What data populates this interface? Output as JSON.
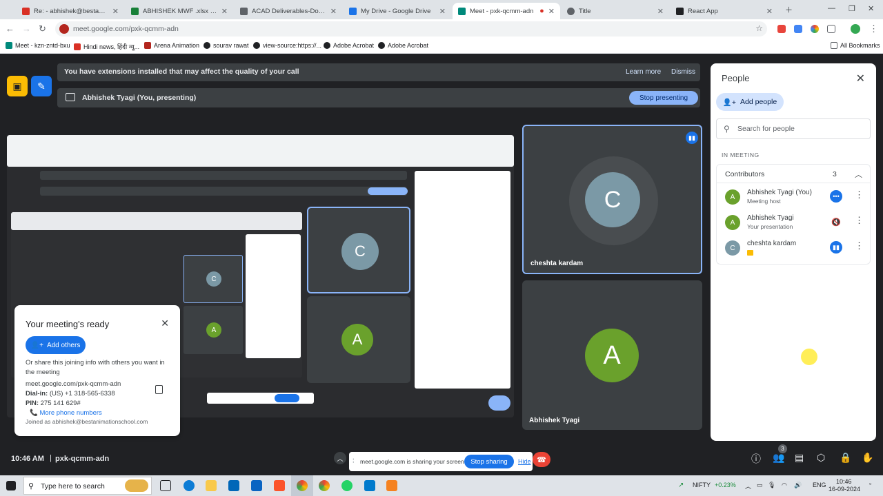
{
  "tabs": [
    {
      "label": "Re: - abhishek@bestanimations",
      "color": "#d93025"
    },
    {
      "label": "ABHISHEK MWF .xlsx - Google",
      "color": "#188038"
    },
    {
      "label": "ACAD Deliverables-Domestic -",
      "color": "#5f6368"
    },
    {
      "label": "My Drive - Google Drive",
      "color": "#1a73e8"
    },
    {
      "label": "Meet - pxk-qcmm-adn",
      "color": "#00897b"
    },
    {
      "label": "Title",
      "color": "#5f6368"
    },
    {
      "label": "React App",
      "color": "#202124"
    }
  ],
  "address": {
    "url": "meet.google.com/pxk-qcmm-adn"
  },
  "bookmarks": [
    {
      "label": "Meet - kzn-zntd-bxu",
      "color": "#00897b"
    },
    {
      "label": "Hindi news, हिंदी न्यू...",
      "color": "#d93025"
    },
    {
      "label": "Arena Animation",
      "color": "#b3261e"
    },
    {
      "label": "sourav rawat",
      "color": "#202124"
    },
    {
      "label": "view-source:https://...",
      "color": "#202124"
    },
    {
      "label": "Adobe Acrobat",
      "color": "#202124"
    },
    {
      "label": "Adobe Acrobat",
      "color": "#202124"
    }
  ],
  "all_bookmarks": "All Bookmarks",
  "banner": {
    "text": "You have extensions installed that may affect the quality of your call",
    "learn_more": "Learn more",
    "dismiss": "Dismiss"
  },
  "presenting": {
    "text": "Abhishek Tyagi (You, presenting)",
    "stop_label": "Stop presenting"
  },
  "tiles": [
    {
      "name": "cheshta kardam",
      "initial": "C",
      "color": "#7b99a6"
    },
    {
      "name": "Abhishek Tyagi",
      "initial": "A",
      "color": "#6aa12c"
    }
  ],
  "people": {
    "title": "People",
    "add_label": "Add people",
    "search_placeholder": "Search for people",
    "section": "IN MEETING",
    "group": "Contributors",
    "count": "3",
    "list": [
      {
        "name": "Abhishek Tyagi (You)",
        "sub": "Meeting host",
        "initial": "A",
        "color": "#6aa12c"
      },
      {
        "name": "Abhishek Tyagi",
        "sub": "Your presentation",
        "initial": "A",
        "color": "#6aa12c"
      },
      {
        "name": "cheshta kardam",
        "sub": "",
        "initial": "C",
        "color": "#7b99a6"
      }
    ]
  },
  "ready": {
    "title": "Your meeting's ready",
    "add_label": "Add others",
    "share_text": "Or share this joining info with others you want in the meeting",
    "link": "meet.google.com/pxk-qcmm-adn",
    "dial_label": "Dial-in:",
    "dial_value": "(US) +1 318-565-6338",
    "pin_label": "PIN:",
    "pin_value": "275 141 629#",
    "more_label": "More phone numbers",
    "joined": "Joined as abhishek@bestanimationschool.com"
  },
  "bottom": {
    "time": "10:46 AM",
    "code": "pxk-qcmm-adn",
    "people_badge": "3"
  },
  "sharing": {
    "text": "meet.google.com is sharing your screen.",
    "stop_label": "Stop sharing",
    "hide_label": "Hide"
  },
  "taskbar": {
    "search_placeholder": "Type here to search",
    "nifty_label": "NIFTY",
    "nifty_change": "+0.23%",
    "lang": "ENG",
    "time": "10:46",
    "date": "16-09-2024"
  }
}
